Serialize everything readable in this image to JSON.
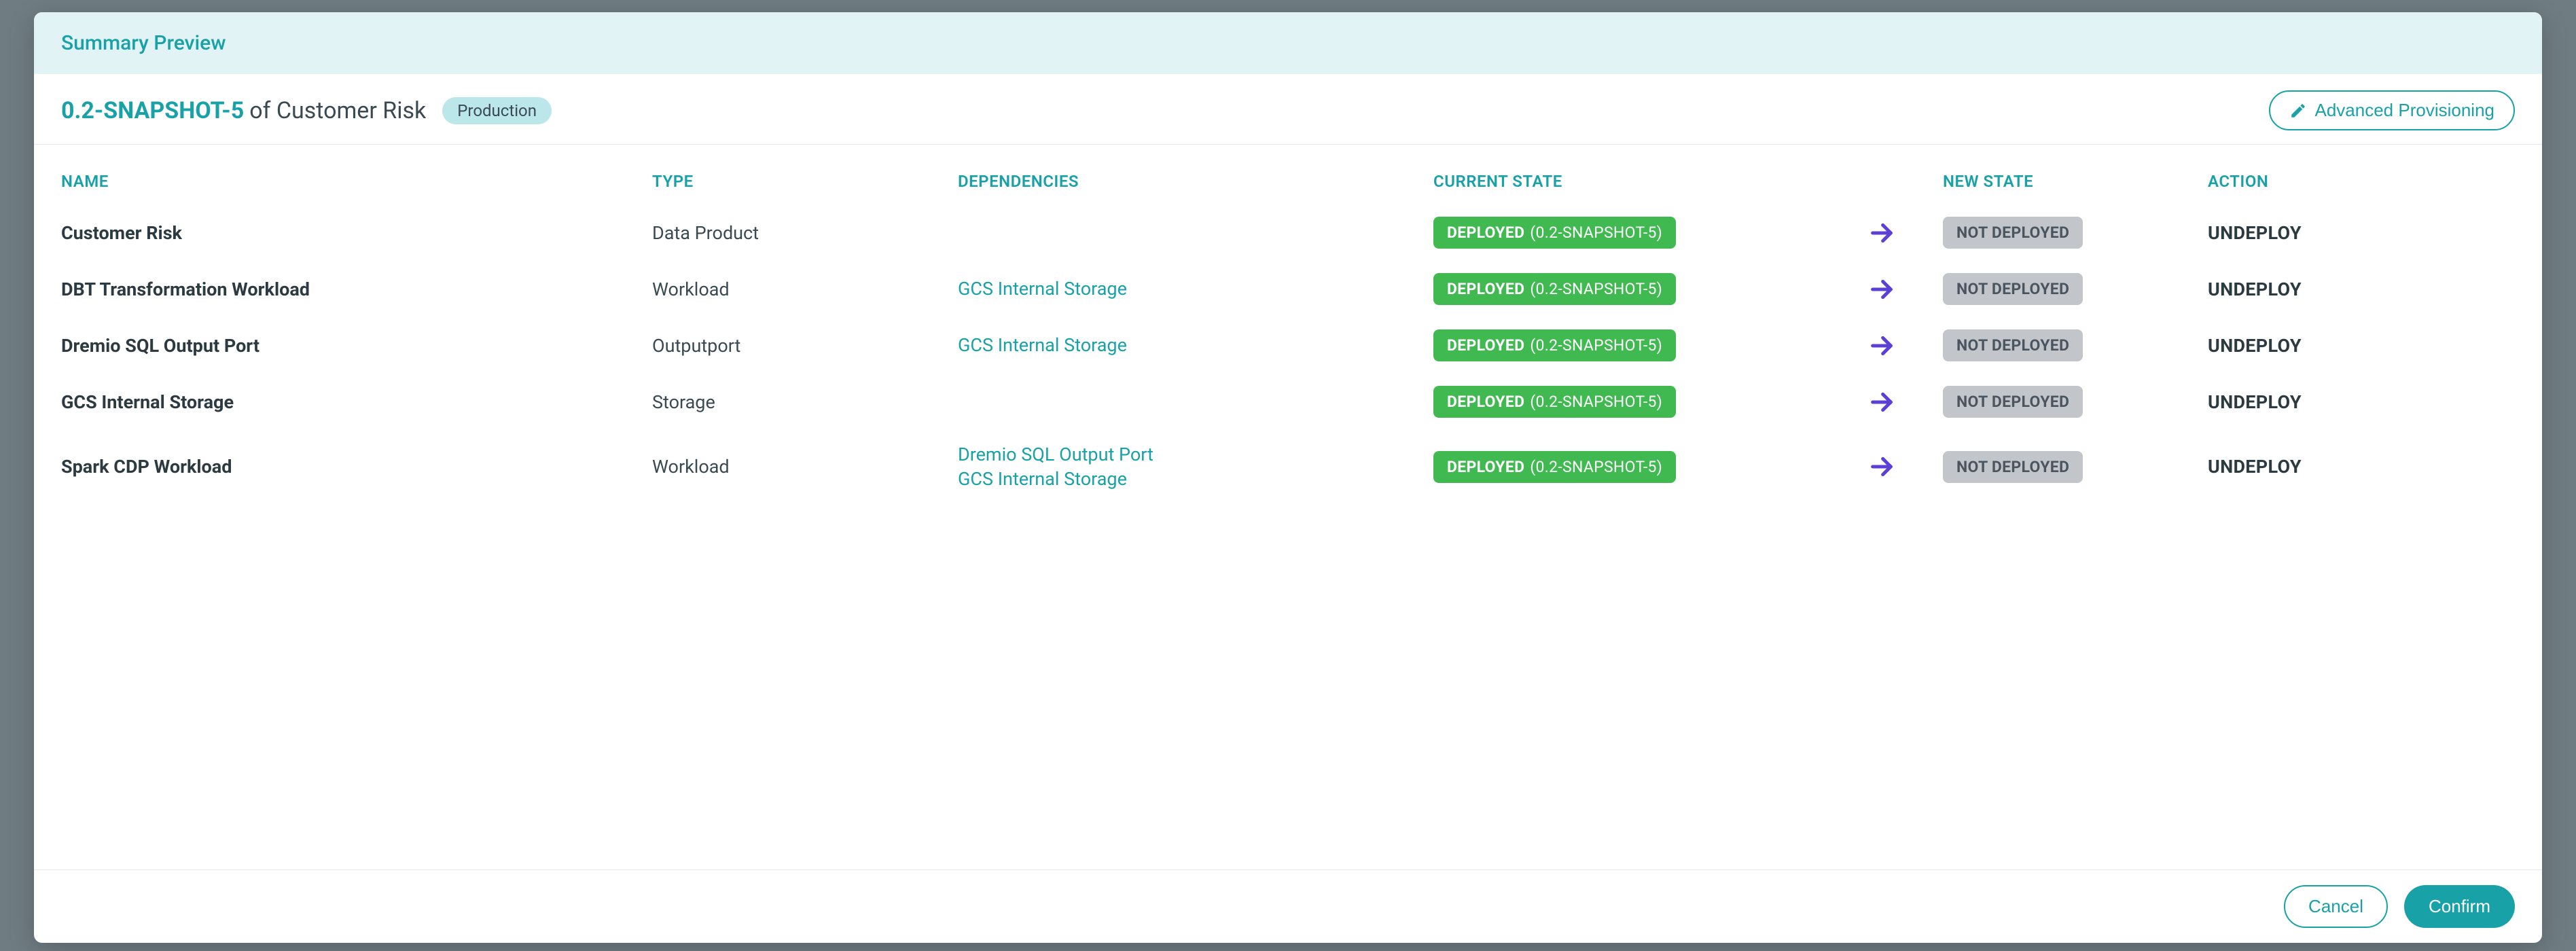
{
  "header": {
    "title": "Summary Preview"
  },
  "title": {
    "version": "0.2-SNAPSHOT-5",
    "of": "of",
    "entity": "Customer Risk",
    "env": "Production",
    "advanced": "Advanced Provisioning"
  },
  "columns": {
    "name": "NAME",
    "type": "TYPE",
    "dependencies": "DEPENDENCIES",
    "current": "CURRENT STATE",
    "newstate": "NEW STATE",
    "action": "ACTION"
  },
  "rows": [
    {
      "name": "Customer Risk",
      "type": "Data Product",
      "deps": [],
      "current_state": "DEPLOYED",
      "current_version": "(0.2-SNAPSHOT-5)",
      "new_state": "NOT DEPLOYED",
      "action": "UNDEPLOY"
    },
    {
      "name": "DBT Transformation Workload",
      "type": "Workload",
      "deps": [
        "GCS Internal Storage"
      ],
      "current_state": "DEPLOYED",
      "current_version": "(0.2-SNAPSHOT-5)",
      "new_state": "NOT DEPLOYED",
      "action": "UNDEPLOY"
    },
    {
      "name": "Dremio SQL Output Port",
      "type": "Outputport",
      "deps": [
        "GCS Internal Storage"
      ],
      "current_state": "DEPLOYED",
      "current_version": "(0.2-SNAPSHOT-5)",
      "new_state": "NOT DEPLOYED",
      "action": "UNDEPLOY"
    },
    {
      "name": "GCS Internal Storage",
      "type": "Storage",
      "deps": [],
      "current_state": "DEPLOYED",
      "current_version": "(0.2-SNAPSHOT-5)",
      "new_state": "NOT DEPLOYED",
      "action": "UNDEPLOY"
    },
    {
      "name": "Spark CDP Workload",
      "type": "Workload",
      "deps": [
        "Dremio SQL Output Port",
        "GCS Internal Storage"
      ],
      "current_state": "DEPLOYED",
      "current_version": "(0.2-SNAPSHOT-5)",
      "new_state": "NOT DEPLOYED",
      "action": "UNDEPLOY"
    }
  ],
  "footer": {
    "cancel": "Cancel",
    "confirm": "Confirm"
  }
}
